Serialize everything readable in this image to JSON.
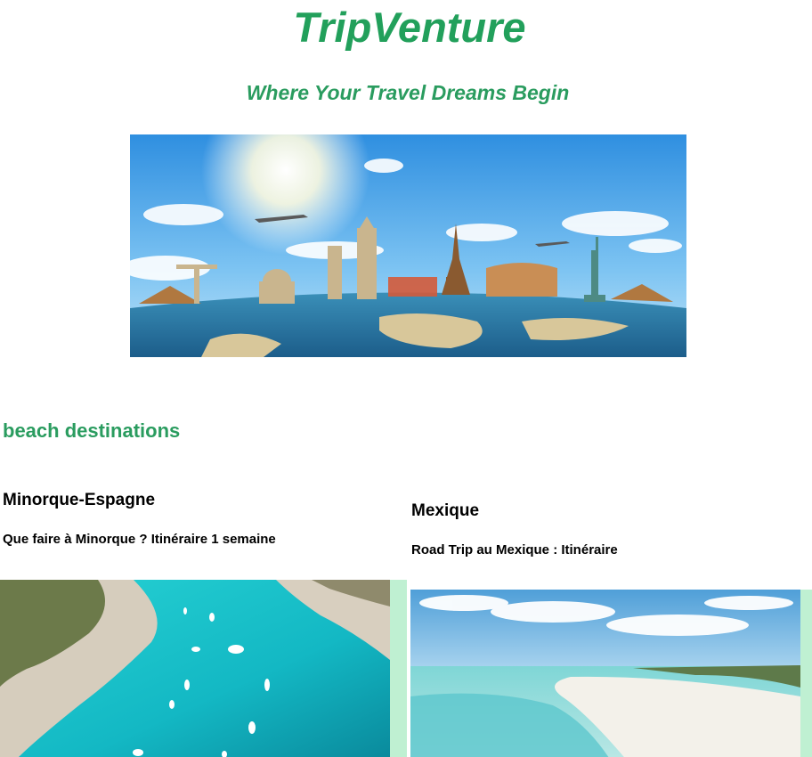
{
  "header": {
    "site_title": "TripVenture",
    "tagline": "Where Your Travel Dreams Begin"
  },
  "hero": {
    "icon": "world-landmarks-image"
  },
  "section": {
    "heading": "beach destinations"
  },
  "destinations": [
    {
      "name": "Minorque-Espagne",
      "description": "Que faire à Minorque ? Itinéraire 1 semaine",
      "icon": "turquoise-cove-boats-image"
    },
    {
      "name": "Mexique",
      "description": "Road Trip au Mexique : Itinéraire",
      "icon": "white-sand-beach-image"
    }
  ],
  "colors": {
    "accent": "#22a05b",
    "card_background": "#bff0d2"
  }
}
